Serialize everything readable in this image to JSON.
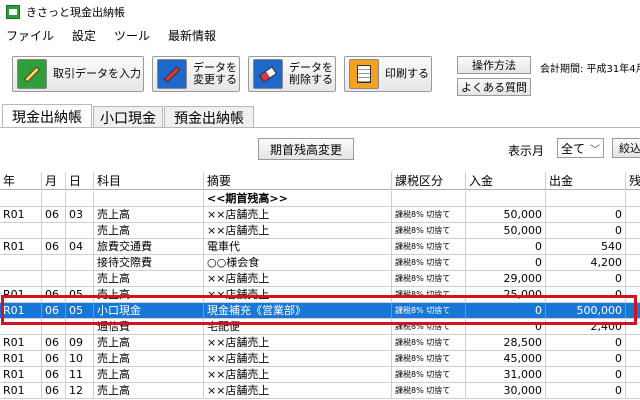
{
  "window": {
    "title": "きさっと現金出納帳"
  },
  "menu": [
    "ファイル",
    "設定",
    "ツール",
    "最新情報"
  ],
  "toolbar": {
    "import_label": "取引データを入力",
    "edit_label": "データを\n変更する",
    "delete_label": "データを\n削除する",
    "print_label": "印刷する",
    "howto_label": "操作方法",
    "faq_label": "よくある質問",
    "period_label": "会計期間: 平成31年4月1"
  },
  "tabs": [
    "現金出納帳",
    "小口現金",
    "預金出納帳"
  ],
  "filter": {
    "opening_balance_button": "期首残高変更",
    "month_label": "表示月",
    "month_value": "全て",
    "narrow_label": "絞込"
  },
  "table": {
    "columns": [
      "年",
      "月",
      "日",
      "科目",
      "摘要",
      "課税区分",
      "入金",
      "出金",
      "残"
    ],
    "rows": [
      [
        "",
        "",
        "",
        "",
        "<<期首残高>>",
        "",
        "",
        "",
        ""
      ],
      [
        "R01",
        "06",
        "03",
        "売上高",
        "××店舗売上",
        "課税8% 切捨て",
        "50,000",
        "0",
        ""
      ],
      [
        "",
        "",
        "",
        "売上高",
        "××店舗売上",
        "課税8% 切捨て",
        "50,000",
        "0",
        ""
      ],
      [
        "R01",
        "06",
        "04",
        "旅費交通費",
        "電車代",
        "課税8% 切捨て",
        "0",
        "540",
        ""
      ],
      [
        "",
        "",
        "",
        "接待交際費",
        "○○様会食",
        "課税8% 切捨て",
        "0",
        "4,200",
        ""
      ],
      [
        "",
        "",
        "",
        "売上高",
        "××店舗売上",
        "課税8% 切捨て",
        "29,000",
        "0",
        ""
      ],
      [
        "R01",
        "06",
        "05",
        "売上高",
        "××店舗売上",
        "課税8% 切捨て",
        "25,000",
        "0",
        ""
      ],
      [
        "R01",
        "06",
        "05",
        "小口現金",
        "現金補充《営業部》",
        "課税8% 切捨て",
        "0",
        "500,000",
        ""
      ],
      [
        "",
        "",
        "",
        "通信費",
        "宅配便",
        "課税8% 切捨て",
        "0",
        "2,400",
        ""
      ],
      [
        "R01",
        "06",
        "09",
        "売上高",
        "××店舗売上",
        "課税8% 切捨て",
        "28,500",
        "0",
        ""
      ],
      [
        "R01",
        "06",
        "10",
        "売上高",
        "××店舗売上",
        "課税8% 切捨て",
        "45,000",
        "0",
        ""
      ],
      [
        "R01",
        "06",
        "11",
        "売上高",
        "××店舗売上",
        "課税8% 切捨て",
        "31,000",
        "0",
        ""
      ],
      [
        "R01",
        "06",
        "12",
        "売上高",
        "××店舗売上",
        "課税8% 切捨て",
        "30,000",
        "0",
        ""
      ]
    ],
    "selected_row": 7
  },
  "colors": {
    "selection": "#1876d6",
    "highlight": "#d4141c"
  }
}
